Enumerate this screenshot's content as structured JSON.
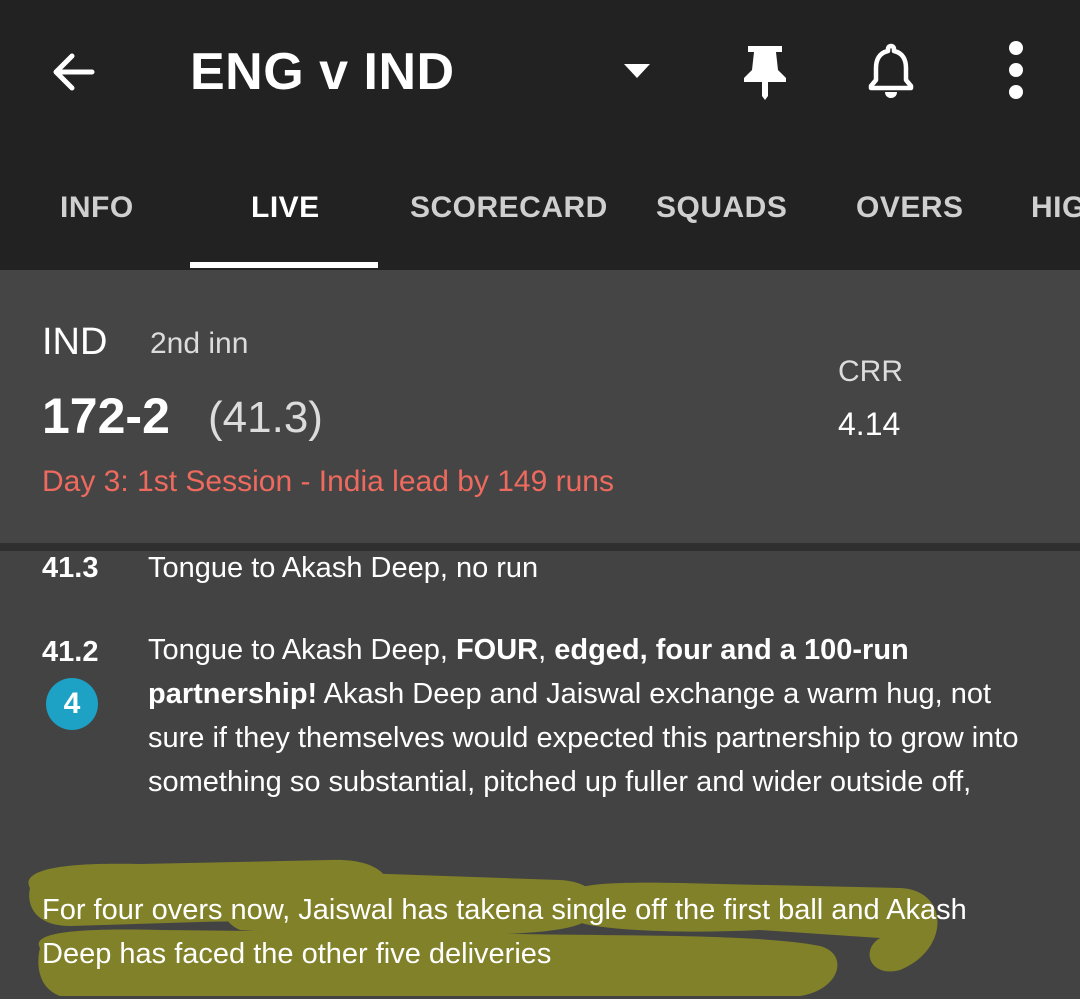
{
  "header": {
    "title": "ENG v IND",
    "icons": [
      "back-arrow-icon",
      "dropdown-icon",
      "pin-icon",
      "bell-icon",
      "more-vert-icon"
    ]
  },
  "tabs": [
    {
      "label": "INFO"
    },
    {
      "label": "LIVE",
      "active": true
    },
    {
      "label": "SCORECARD"
    },
    {
      "label": "SQUADS"
    },
    {
      "label": "OVERS"
    },
    {
      "label": "HIG"
    }
  ],
  "score": {
    "team": "IND",
    "innings": "2nd inn",
    "runs_wickets": "172-2",
    "overs": "(41.3)",
    "crr_label": "CRR",
    "crr_value": "4.14",
    "status": "Day 3: 1st Session - India lead by 149 runs"
  },
  "commentary": [
    {
      "over": "41.3",
      "text": "Tongue to Akash Deep, no run"
    },
    {
      "over": "41.2",
      "badge": "4",
      "lead": "Tongue to Akash Deep, ",
      "bold1": "FOUR",
      "mid": ", ",
      "bold2": "edged, four and a 100-run partnership!",
      "rest": " Akash Deep and Jaiswal exchange a warm hug, not sure if they themselves would expected this partnership to grow into something so substantial, pitched up fuller and wider outside off,"
    }
  ],
  "note": "For four overs now, Jaiswal has takena  single off the first ball and Akash Deep has faced the other five deliveries",
  "colors": {
    "app_bar": "#222222",
    "background": "#434343",
    "status_text": "#ee6a5e",
    "four_badge": "#1da1c4",
    "highlighter": "#a8a81a"
  }
}
